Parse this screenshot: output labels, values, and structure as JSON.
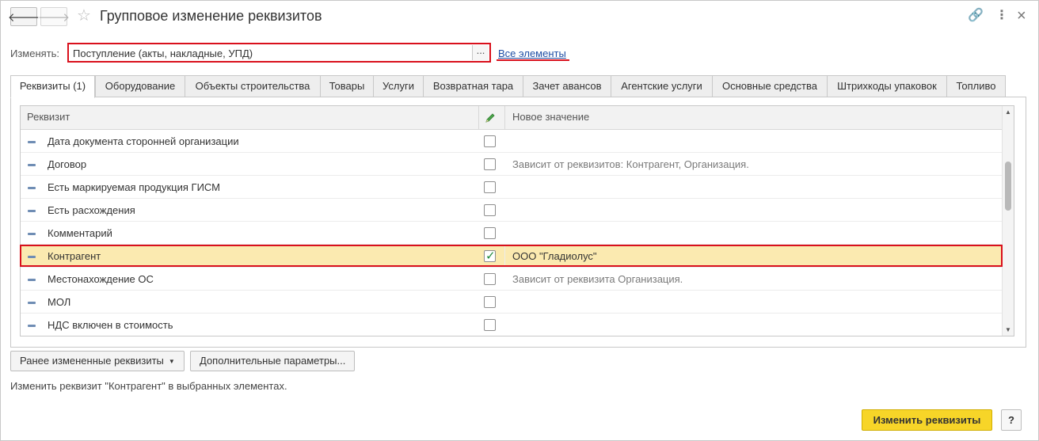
{
  "window": {
    "title": "Групповое изменение реквизитов",
    "nav_back": "🡐",
    "nav_forward": "🡒",
    "star_icon": "☆",
    "link_icon": "🔗",
    "menu_icon": "⋮",
    "close_icon": "×"
  },
  "change_to": {
    "label": "Изменять:",
    "value": "Поступление (акты, накладные, УПД)",
    "select_btn": "...",
    "all_elements_link": "Все элементы"
  },
  "tabs": [
    {
      "label": "Реквизиты (1)",
      "active": true
    },
    {
      "label": "Оборудование"
    },
    {
      "label": "Объекты строительства"
    },
    {
      "label": "Товары"
    },
    {
      "label": "Услуги"
    },
    {
      "label": "Возвратная тара"
    },
    {
      "label": "Зачет авансов"
    },
    {
      "label": "Агентские услуги"
    },
    {
      "label": "Основные средства"
    },
    {
      "label": "Штрихкоды упаковок"
    },
    {
      "label": "Топливо"
    }
  ],
  "grid": {
    "col_attribute": "Реквизит",
    "col_new_value": "Новое значение",
    "rows": [
      {
        "name": "Дата документа сторонней организации",
        "checked": false,
        "new_value": ""
      },
      {
        "name": "Договор",
        "checked": false,
        "new_value": "Зависит от реквизитов: Контрагент, Организация."
      },
      {
        "name": "Есть маркируемая продукция ГИСМ",
        "checked": false,
        "new_value": ""
      },
      {
        "name": "Есть расхождения",
        "checked": false,
        "new_value": ""
      },
      {
        "name": "Комментарий",
        "checked": false,
        "new_value": ""
      },
      {
        "name": "Контрагент",
        "checked": true,
        "new_value": "ООО \"Гладиолус\"",
        "selected": true
      },
      {
        "name": "Местонахождение ОС",
        "checked": false,
        "new_value": "Зависит от реквизита Организация."
      },
      {
        "name": "МОЛ",
        "checked": false,
        "new_value": ""
      },
      {
        "name": "НДС включен в стоимость",
        "checked": false,
        "new_value": ""
      }
    ]
  },
  "buttons": {
    "previously_changed": "Ранее измененные реквизиты",
    "additional_params": "Дополнительные параметры...",
    "apply": "Изменить реквизиты",
    "help": "?"
  },
  "hint": "Изменить реквизит \"Контрагент\" в выбранных элементах."
}
